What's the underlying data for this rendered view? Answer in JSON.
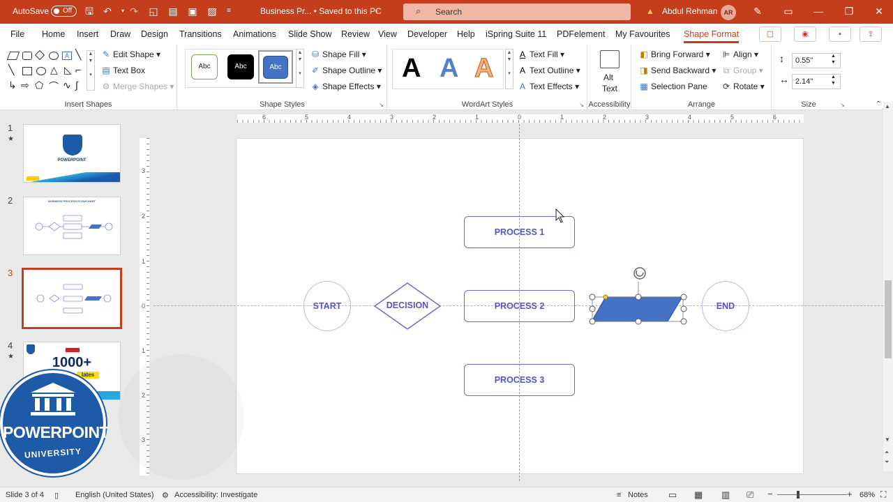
{
  "titlebar": {
    "autosave_label": "AutoSave",
    "autosave_state": "Off",
    "doc_title": "Business Pr...  •  Saved to this PC",
    "search_placeholder": "Search",
    "user_name": "Abdul Rehman",
    "user_initials": "AR",
    "bg_color": "#c43e1c"
  },
  "tabs": [
    "File",
    "Home",
    "Insert",
    "Draw",
    "Design",
    "Transitions",
    "Animations",
    "Slide Show",
    "Review",
    "View",
    "Developer",
    "Help",
    "iSpring Suite 11",
    "PDFelement",
    "My Favourites",
    "Shape Format"
  ],
  "active_tab": "Shape Format",
  "ribbon": {
    "insert_shapes": {
      "edit_shape": "Edit Shape",
      "text_box": "Text Box",
      "merge_shapes": "Merge Shapes",
      "label": "Insert Shapes"
    },
    "shape_styles": {
      "preset1": "Abc",
      "preset2": "Abc",
      "preset3": "Abc",
      "shape_fill": "Shape Fill",
      "shape_outline": "Shape Outline",
      "shape_effects": "Shape Effects",
      "label": "Shape Styles"
    },
    "wordart": {
      "letter": "A",
      "text_fill": "Text Fill",
      "text_outline": "Text Outline",
      "text_effects": "Text Effects",
      "label": "WordArt Styles"
    },
    "accessibility": {
      "alt_text_1": "Alt",
      "alt_text_2": "Text",
      "label": "Accessibility"
    },
    "arrange": {
      "bring_forward": "Bring Forward",
      "send_backward": "Send Backward",
      "selection_pane": "Selection Pane",
      "align": "Align",
      "group": "Group",
      "rotate": "Rotate",
      "label": "Arrange"
    },
    "size": {
      "height": "0.55\"",
      "width": "2.14\"",
      "label": "Size"
    }
  },
  "slides": [
    {
      "num": "1",
      "star": "★"
    },
    {
      "num": "2",
      "star": ""
    },
    {
      "num": "3",
      "star": ""
    },
    {
      "num": "4",
      "star": "★"
    }
  ],
  "thumb_text": {
    "s1_brand": "POWERPOINT",
    "s2_title": "BUSINESS PROCESS FLOWCHART",
    "s4_big": "1000+",
    "s4_small": "lates"
  },
  "ruler": {
    "h_ticks": [
      "6",
      "5",
      "4",
      "3",
      "2",
      "1",
      "0",
      "1",
      "2",
      "3",
      "4",
      "5",
      "6"
    ],
    "v_ticks": [
      "3",
      "2",
      "1",
      "0",
      "1",
      "2",
      "3"
    ]
  },
  "flowchart": {
    "start": "START",
    "decision": "DECISION",
    "process1": "PROCESS 1",
    "process2": "PROCESS 2",
    "process3": "PROCESS 3",
    "end": "END",
    "stroke_color": "#6c68d8",
    "fill_color": "#4472c4"
  },
  "watermark": {
    "line1": "POWERPOINT",
    "line2": "UNIVERSITY"
  },
  "status": {
    "slide_info": "Slide 3 of 4",
    "language": "English (United States)",
    "accessibility": "Accessibility: Investigate",
    "notes": "Notes",
    "zoom": "68%"
  }
}
